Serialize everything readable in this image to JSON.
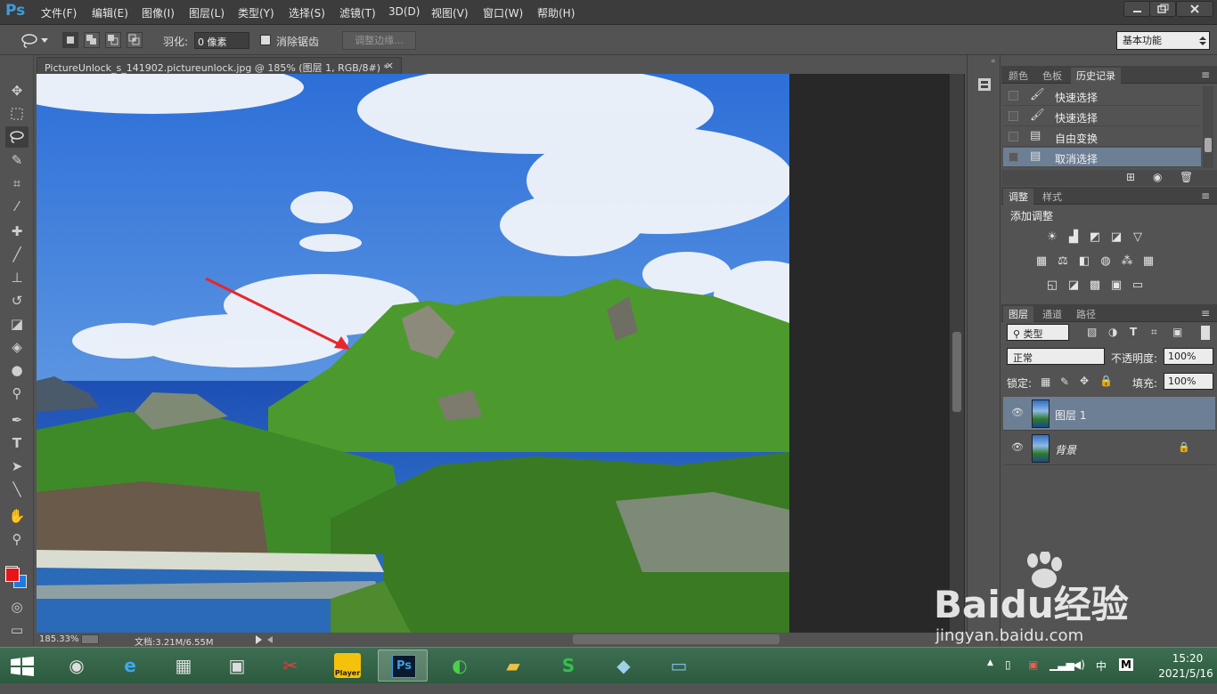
{
  "app": {
    "logo": "Ps",
    "menu": [
      "文件(F)",
      "编辑(E)",
      "图像(I)",
      "图层(L)",
      "类型(Y)",
      "选择(S)",
      "滤镜(T)",
      "3D(D)",
      "视图(V)",
      "窗口(W)",
      "帮助(H)"
    ]
  },
  "options": {
    "feather_label": "羽化:",
    "feather_value": "0 像素",
    "antialias_label": "消除锯齿",
    "refine_edge_label": "调整边缘...",
    "workspace": "基本功能"
  },
  "document": {
    "tab_title": "PictureUnlock_s_141902.pictureunlock.jpg @ 185% (图层 1, RGB/8#) *",
    "close": "×",
    "zoom": "185.33%",
    "doc_info": "文档:3.21M/6.55M"
  },
  "history_panel": {
    "tabs": [
      "颜色",
      "色板",
      "历史记录"
    ],
    "active_tab": 2,
    "items": [
      "快速选择",
      "快速选择",
      "自由变换",
      "取消选择"
    ],
    "selected_index": 3
  },
  "adjustments_panel": {
    "tabs": [
      "调整",
      "样式"
    ],
    "title": "添加调整"
  },
  "layers_panel": {
    "tabs": [
      "图层",
      "通道",
      "路径"
    ],
    "filter": "类型",
    "blend_mode": "正常",
    "opacity_label": "不透明度:",
    "opacity": "100%",
    "lock_label": "锁定:",
    "fill_label": "填充:",
    "fill": "100%",
    "layers": [
      {
        "name": "图层 1",
        "selected": true,
        "locked": false
      },
      {
        "name": "背景",
        "selected": false,
        "locked": true
      }
    ]
  },
  "colors": {
    "foreground": "#e8141a",
    "background": "#1e7be0",
    "accent_ps": "#3c9ddc"
  },
  "taskbar": {
    "time": "15:20",
    "date": "2021/5/16",
    "ime": "中",
    "ime_mode": "M",
    "player_label": "Player"
  },
  "watermark": {
    "brand": "Baidu经验",
    "url": "jingyan.baidu.com"
  }
}
